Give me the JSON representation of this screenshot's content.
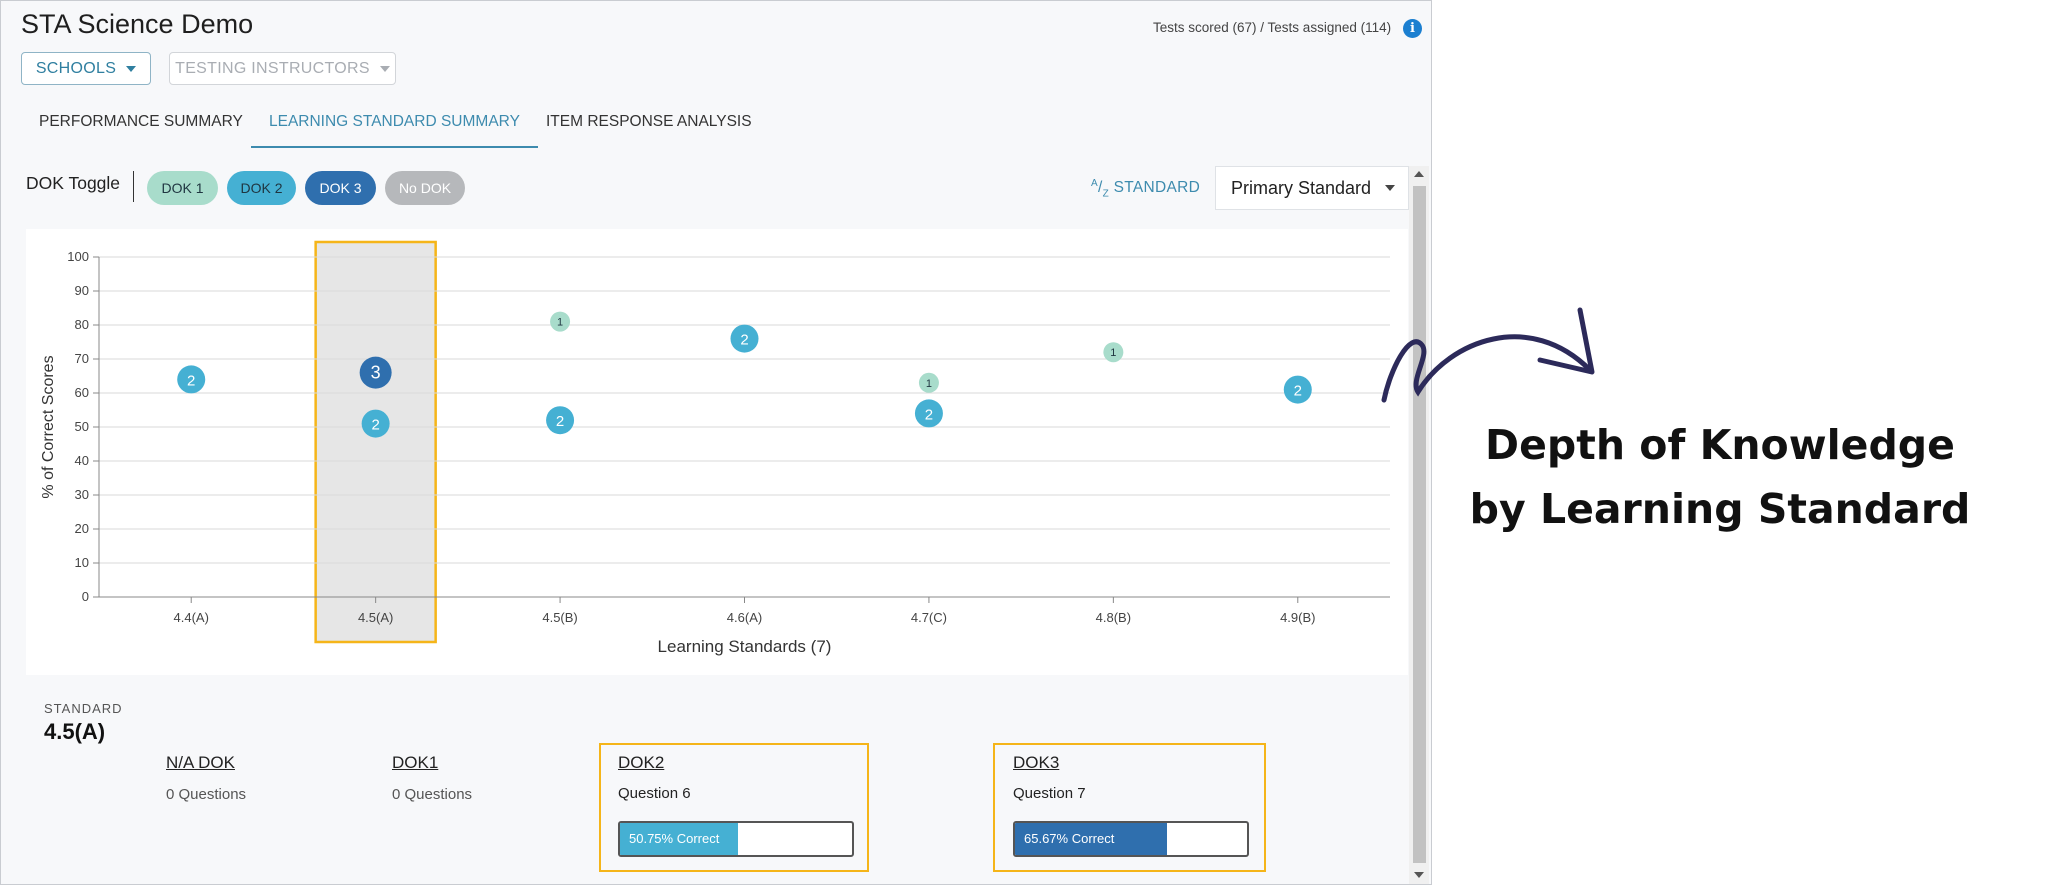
{
  "app": {
    "title": "STA Science Demo",
    "tests_scored": "Tests scored (67) / Tests assigned (114)",
    "info_icon": "info-icon"
  },
  "filters": {
    "schools": "SCHOOLS",
    "instructors": "TESTING INSTRUCTORS"
  },
  "tabs": [
    {
      "label": "PERFORMANCE SUMMARY",
      "active": false
    },
    {
      "label": "LEARNING STANDARD SUMMARY",
      "active": true
    },
    {
      "label": "ITEM RESPONSE ANALYSIS",
      "active": false
    }
  ],
  "dok_toggle": {
    "label": "DOK Toggle",
    "pills": [
      "DOK 1",
      "DOK 2",
      "DOK 3",
      "No DOK"
    ]
  },
  "sort": {
    "az_a": "A",
    "az_z": "Z",
    "az_label": "STANDARD",
    "primary_standard": "Primary Standard"
  },
  "colors": {
    "dok1": "#a8dccb",
    "dok2": "#45b0d3",
    "dok3": "#2f6fae",
    "no_dok": "#b6b8bb",
    "highlight": "#f5b519",
    "accent": "#3d8bae"
  },
  "chart_data": {
    "type": "scatter",
    "ylabel": "% of Correct Scores",
    "xlabel": "Learning Standards (7)",
    "categories": [
      "4.4(A)",
      "4.5(A)",
      "4.5(B)",
      "4.6(A)",
      "4.7(C)",
      "4.8(B)",
      "4.9(B)"
    ],
    "ylim": [
      0,
      100
    ],
    "yticks": [
      0,
      10,
      20,
      30,
      40,
      50,
      60,
      70,
      80,
      90,
      100
    ],
    "grid": true,
    "selected_category": "4.5(A)",
    "points": [
      {
        "category": "4.4(A)",
        "y": 64,
        "dok": 2
      },
      {
        "category": "4.5(A)",
        "y": 66,
        "dok": 3
      },
      {
        "category": "4.5(A)",
        "y": 51,
        "dok": 2
      },
      {
        "category": "4.5(B)",
        "y": 81,
        "dok": 1
      },
      {
        "category": "4.5(B)",
        "y": 52,
        "dok": 2
      },
      {
        "category": "4.6(A)",
        "y": 76,
        "dok": 2
      },
      {
        "category": "4.7(C)",
        "y": 63,
        "dok": 1
      },
      {
        "category": "4.7(C)",
        "y": 54,
        "dok": 2
      },
      {
        "category": "4.8(B)",
        "y": 72,
        "dok": 1
      },
      {
        "category": "4.9(B)",
        "y": 61,
        "dok": 2
      }
    ]
  },
  "detail": {
    "standard_label": "STANDARD",
    "standard_value": "4.5(A)",
    "na_dok": {
      "heading": "N/A DOK",
      "sub": "0 Questions"
    },
    "dok1": {
      "heading": "DOK1",
      "sub": "0 Questions"
    },
    "dok2": {
      "heading": "DOK2",
      "question": "Question 6",
      "percent": 50.75,
      "bar_label": "50.75% Correct"
    },
    "dok3": {
      "heading": "DOK3",
      "question": "Question 7",
      "percent": 65.67,
      "bar_label": "65.67% Correct"
    }
  },
  "annotation": {
    "line1": "Depth of Knowledge",
    "line2": "by Learning Standard"
  }
}
